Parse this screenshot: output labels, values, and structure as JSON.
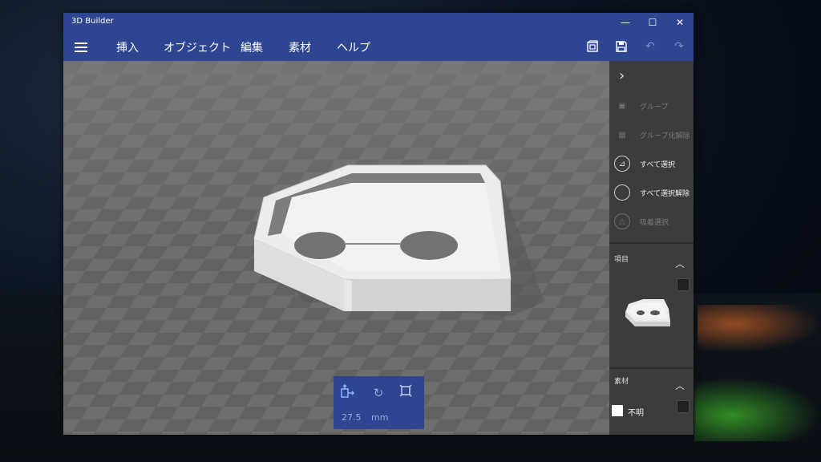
{
  "window": {
    "title": "3D Builder"
  },
  "window_controls": {
    "minimize": "—",
    "maximize": "☐",
    "close": "✕"
  },
  "menu": {
    "items": [
      "挿入",
      "オブジェクト",
      "編集",
      "素材",
      "ヘルプ"
    ]
  },
  "toolbar": {
    "icons": [
      "3d-view-icon",
      "save-icon",
      "undo-icon",
      "redo-icon"
    ],
    "undo_enabled": false,
    "redo_enabled": false
  },
  "panel": {
    "actions": [
      {
        "label": "グループ",
        "enabled": false,
        "icon": "group-icon"
      },
      {
        "label": "グループ化解除",
        "enabled": false,
        "icon": "ungroup-icon"
      },
      {
        "label": "すべて選択",
        "enabled": true,
        "icon": "select-all-icon"
      },
      {
        "label": "すべて選択解除",
        "enabled": true,
        "icon": "deselect-all-icon"
      },
      {
        "label": "吸着選択",
        "enabled": false,
        "icon": "snap-select-icon"
      }
    ],
    "items_title": "項目",
    "material_title": "素材",
    "material_label": "不明"
  },
  "transform": {
    "value": "27.5",
    "unit": "mm",
    "icons": [
      "move-icon",
      "rotate-icon",
      "scale-icon"
    ]
  },
  "colors": {
    "accent": "#2e4591",
    "panel": "#3c3c3c",
    "viewport": "#6b6b6b",
    "model": "#e8e8e8"
  }
}
